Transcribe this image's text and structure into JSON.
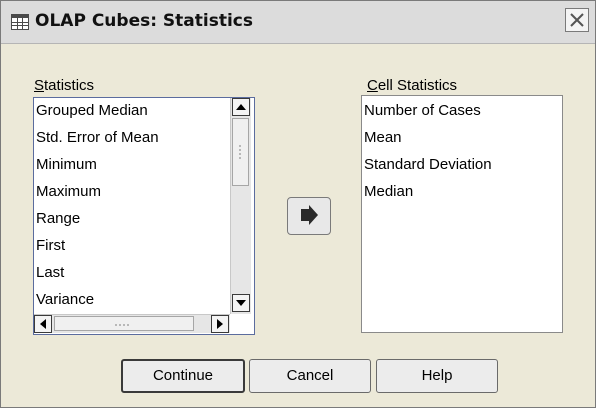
{
  "window": {
    "title": "OLAP Cubes: Statistics"
  },
  "statistics": {
    "label_accesskey": "S",
    "label_rest": "tatistics",
    "items": [
      "Grouped Median",
      "Std. Error of Mean",
      "Minimum",
      "Maximum",
      "Range",
      "First",
      "Last",
      "Variance"
    ]
  },
  "cell_statistics": {
    "label_accesskey": "C",
    "label_rest": "ell Statistics",
    "items": [
      "Number of Cases",
      "Mean",
      "Standard Deviation",
      "Median"
    ]
  },
  "buttons": {
    "continue": "Continue",
    "cancel": "Cancel",
    "help": "Help"
  },
  "icons": {
    "app": "table-grid-icon",
    "close": "close-icon",
    "move": "arrow-right-icon"
  }
}
